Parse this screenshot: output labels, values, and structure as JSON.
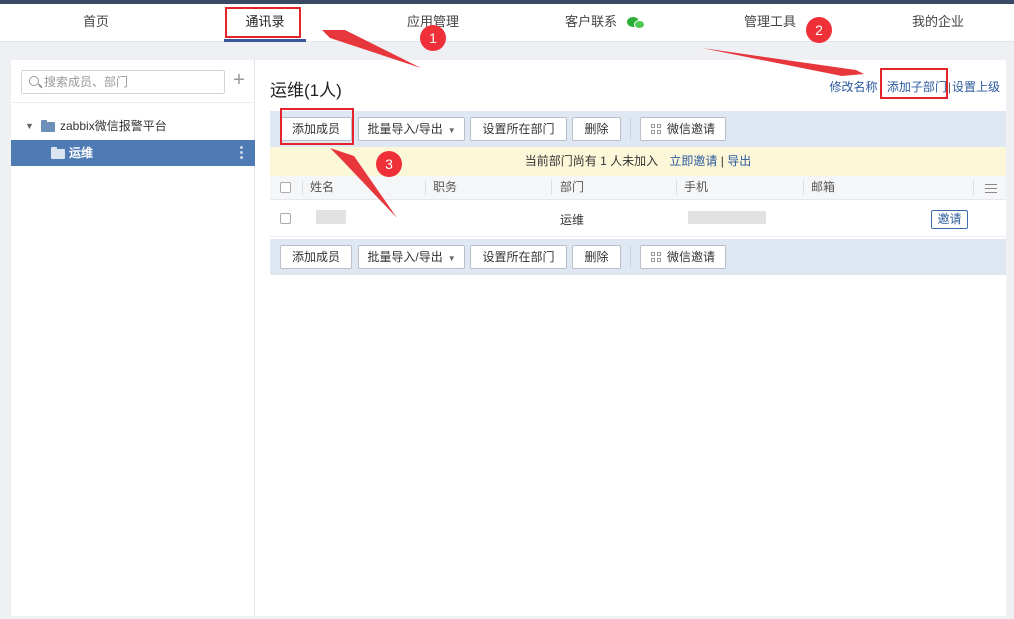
{
  "nav": {
    "items": [
      "首页",
      "通讯录",
      "应用管理",
      "客户联系",
      "管理工具",
      "我的企业"
    ],
    "active_index": 1
  },
  "sidebar": {
    "search_placeholder": "搜索成员、部门",
    "add_icon": "plus-icon",
    "tree_root": "zabbix微信报警平台",
    "tree_selected": "运维"
  },
  "main": {
    "dept_title": "运维(1人)",
    "links": {
      "rename": "修改名称",
      "add_sub_dept": "添加子部门",
      "set_parent": "设置上级",
      "separator": "|"
    },
    "toolbar": {
      "add_member": "添加成员",
      "batch_import_export": "批量导入/导出",
      "set_dept": "设置所在部门",
      "delete": "删除",
      "wechat_invite": "微信邀请"
    },
    "notice": {
      "text": "当前部门尚有 1 人未加入",
      "invite_now": "立即邀请",
      "separator": "|",
      "export": "导出"
    },
    "table": {
      "columns": [
        "姓名",
        "职务",
        "部门",
        "手机",
        "邮箱"
      ],
      "rows": [
        {
          "name": "",
          "title": "",
          "dept": "运维",
          "phone": "",
          "email": "",
          "action": "邀请"
        }
      ]
    }
  },
  "annotations": {
    "badges": [
      "1",
      "2",
      "3"
    ],
    "color": "#e3242b"
  },
  "colors": {
    "nav_accent": "#3b5998",
    "selected_bg": "#4e7bb3",
    "link": "#2b5a9e",
    "toolbar_bg": "#dfe7f2",
    "notice_bg": "#fdf7d9"
  }
}
